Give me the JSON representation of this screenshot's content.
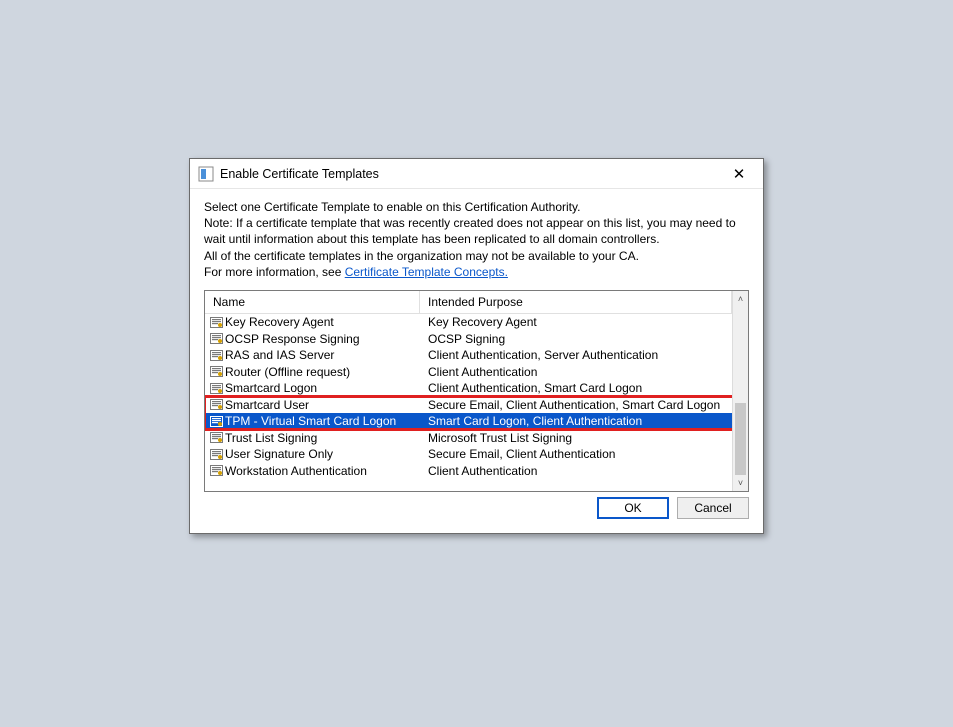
{
  "dialog": {
    "title": "Enable Certificate Templates",
    "instructions": {
      "line1": "Select one Certificate Template to enable on this Certification Authority.",
      "line2": "Note: If a certificate template that was recently created does not appear on this list, you may need to wait until information about this template has been replicated to all domain controllers.",
      "line3": "All of the certificate templates in the organization may not be available to your CA.",
      "more_prefix": "For more information, see ",
      "more_link": "Certificate Template Concepts."
    },
    "columns": {
      "name": "Name",
      "purpose": "Intended Purpose"
    },
    "rows": [
      {
        "name": "Key Recovery Agent",
        "purpose": "Key Recovery Agent",
        "selected": false
      },
      {
        "name": "OCSP Response Signing",
        "purpose": "OCSP Signing",
        "selected": false
      },
      {
        "name": "RAS and IAS Server",
        "purpose": "Client Authentication, Server Authentication",
        "selected": false
      },
      {
        "name": "Router (Offline request)",
        "purpose": "Client Authentication",
        "selected": false
      },
      {
        "name": "Smartcard Logon",
        "purpose": "Client Authentication, Smart Card Logon",
        "selected": false
      },
      {
        "name": "Smartcard User",
        "purpose": "Secure Email, Client Authentication, Smart Card Logon",
        "selected": false
      },
      {
        "name": "TPM - Virtual Smart Card Logon",
        "purpose": "Smart Card Logon, Client Authentication",
        "selected": true
      },
      {
        "name": "Trust List Signing",
        "purpose": "Microsoft Trust List Signing",
        "selected": false
      },
      {
        "name": "User Signature Only",
        "purpose": "Secure Email, Client Authentication",
        "selected": false
      },
      {
        "name": "Workstation Authentication",
        "purpose": "Client Authentication",
        "selected": false
      }
    ],
    "buttons": {
      "ok": "OK",
      "cancel": "Cancel"
    }
  }
}
